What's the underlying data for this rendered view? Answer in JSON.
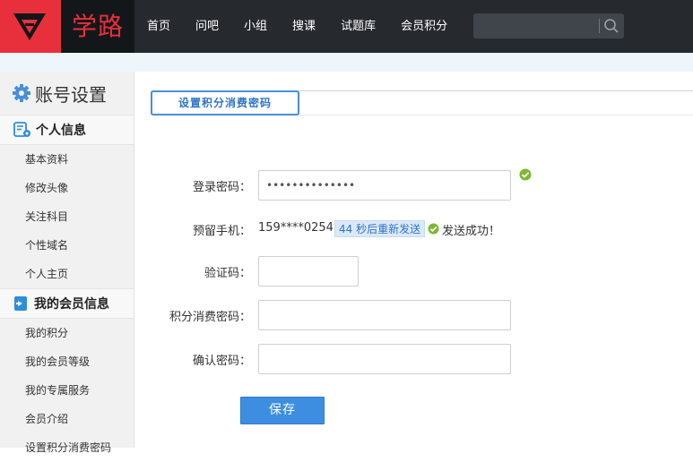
{
  "logo": {
    "text": "学路"
  },
  "nav": {
    "items": [
      "首页",
      "问吧",
      "小组",
      "搜课",
      "试题库",
      "会员积分"
    ]
  },
  "search": {
    "value": "",
    "placeholder": ""
  },
  "sidebar": {
    "title": "账号设置",
    "groups": [
      {
        "label": "个人信息",
        "items": [
          "基本资料",
          "修改头像",
          "关注科目",
          "个性域名",
          "个人主页"
        ]
      },
      {
        "label": "我的会员信息",
        "items": [
          "我的积分",
          "我的会员等级",
          "我的专属服务",
          "会员介绍",
          "设置积分消费密码"
        ]
      }
    ]
  },
  "main": {
    "tab_label": "设置积分消费密码",
    "login_password": {
      "label": "登录密码：",
      "value": "••••••••••••••"
    },
    "phone": {
      "label": "预留手机：",
      "value": "159****0254",
      "resend": "44 秒后重新发送",
      "status": "发送成功！"
    },
    "verify_code": {
      "label": "验证码：",
      "value": ""
    },
    "points_password": {
      "label": "积分消费密码：",
      "value": ""
    },
    "confirm_password": {
      "label": "确认密码：",
      "value": ""
    },
    "save_label": "保存"
  },
  "colors": {
    "brand_red": "#e8303c",
    "topbar": "#262a2f",
    "accent_blue": "#3d8ee0",
    "success_green": "#7cb82f"
  }
}
